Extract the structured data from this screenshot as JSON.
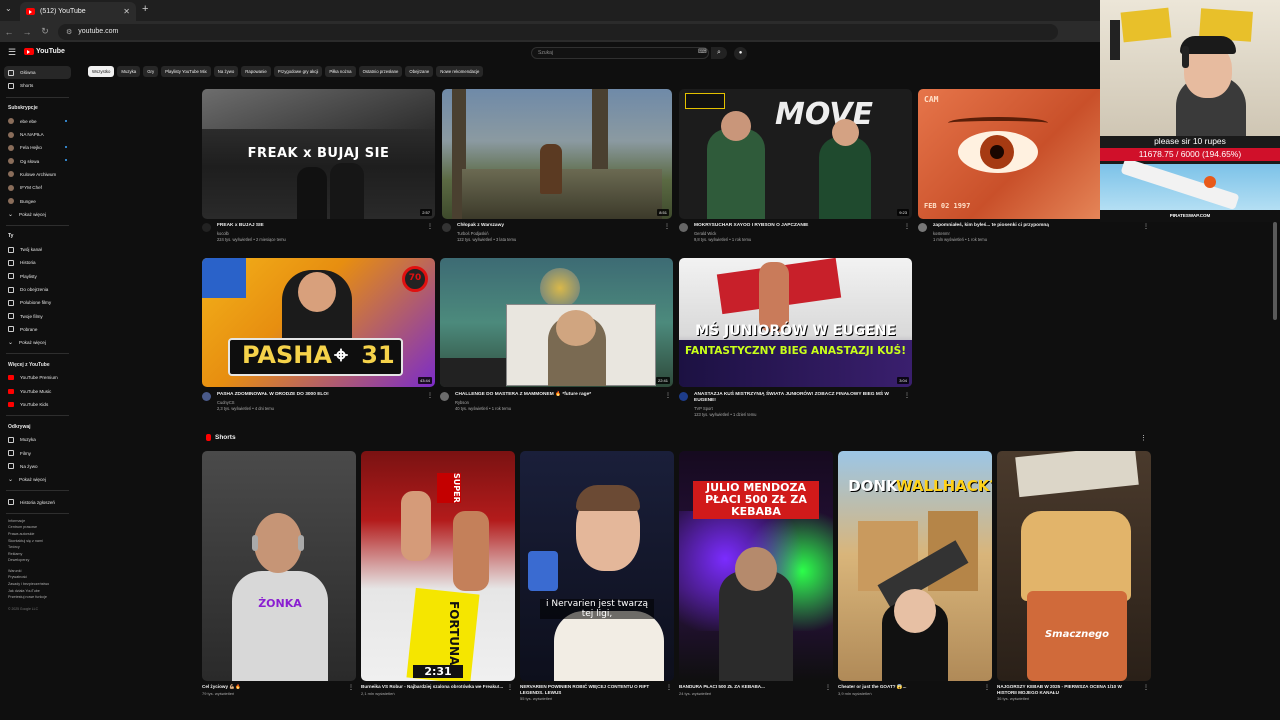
{
  "browser": {
    "tab_title": "(512) YouTube",
    "url": "youtube.com"
  },
  "yt": {
    "logo_text": "YouTube",
    "search_placeholder": "Szukaj"
  },
  "sidebar": {
    "home": "Główna",
    "shorts": "Shorts",
    "subs_header": "Subskrypcje",
    "subs": [
      "ebe ebe",
      "NA NAPIŁA",
      "Fela Hejko",
      "Og słowa",
      "Kulowe Archiwum",
      "IFYM Chef",
      "Bungee",
      "Pokaż więcej"
    ],
    "you_header": "Ty",
    "you": [
      "Twój kanał",
      "Historia",
      "Playlisty",
      "Do obejrzenia",
      "Polubione filmy",
      "Twoje filmy",
      "Pobrane",
      "Pokaż więcej"
    ],
    "more_header": "Więcej z YouTube",
    "more": [
      "YouTube Premium",
      "YouTube Music",
      "YouTube Kids"
    ],
    "explore_header": "Odkrywaj",
    "explore": [
      "Muzyka",
      "Filmy",
      "Na żywo",
      "Pokaż więcej"
    ],
    "history_reports": "Historia zgłoszeń",
    "footer1": [
      "Informacje",
      "Centrum prasowe",
      "Prawa autorskie",
      "Skontaktuj się z nami",
      "Twórcy",
      "Reklamy",
      "Deweloperzy"
    ],
    "footer2": [
      "Warunki",
      "Prywatność",
      "Zasady i bezpieczeństwo",
      "Jak działa YouTube",
      "Przetestuj nowe funkcje"
    ],
    "copyright": "© 2025 Google LLC"
  },
  "chips": [
    "Wszystko",
    "Muzyka",
    "Gry",
    "Playlisty YouTube Mix",
    "Na żywo",
    "Rapowanie",
    "Przygodowe gry akcji",
    "Piłka nożna",
    "Ostatnio przesłane",
    "Obejrzane",
    "Nowe rekomendacje"
  ],
  "videos": [
    {
      "title": "FREAK x BUJAJ SIE",
      "channel": "kocolb",
      "views": "224 tys. wyświetleń • 2 miesiące temu",
      "duration": "2:57",
      "thumb_text": "FREAK x BUJAJ SIE"
    },
    {
      "title": "Chłopak z Warszawy",
      "channel": "Turboś Podjaskiń",
      "views": "122 tys. wyświetleń • 3 lata temu",
      "duration": "8:51"
    },
    {
      "title": "MOKRYSUCHAR XAYOO I RYBSON O JAPCZANIE",
      "channel": "Gerald Wick",
      "views": "9,8 tys. wyświetleń • 1 rok temu",
      "duration": "9:23",
      "thumb_text": "MOVE"
    },
    {
      "title": "zapomniałeś, kim byłeś... te piosenki ci przypomną",
      "channel": "kostenmr",
      "views": "1 mln wyświetleń • 1 rok temu",
      "duration": "",
      "thumb_text": "CAM",
      "thumb_date": "FEB 02 1997"
    },
    {
      "title": "PASHA ZDOMINOWAŁ W DRODZE DO 3000 ELO!",
      "channel": "CudnyCS",
      "views": "2,3 tys. wyświetleń • 4 dni temu",
      "duration": "43:44",
      "thumb_text": "PASHA",
      "thumb_num": "31",
      "thumb_badge": "70"
    },
    {
      "title": "CHALLENGE DO MASTERA Z MAMMONEM 🔥 *future rage*",
      "channel": "Rybson",
      "views": "40 tys. wyświetleń • 1 rok temu",
      "duration": "22:41"
    },
    {
      "title": "ANASTAZJA KUŚ MISTRZYNIĄ ŚWIATA JUNIORÓW! ZOBACZ FINAŁOWY BIEG MŚ W EUGENE!",
      "channel": "TVP Sport",
      "views": "123 tys. wyświetleń • 1 dzień temu",
      "duration": "3:04",
      "thumb_text_1": "MŚ JUNIORÓW W EUGENE",
      "thumb_text_2": "FANTASTYCZNY BIEG ANASTAZJI KUŚ!"
    }
  ],
  "shorts": {
    "header": "Shorts",
    "items": [
      {
        "title": "Cel życiowy 💪🏼🔥",
        "views": "79 tys. wyświetleń",
        "overlay": "ŻONKA"
      },
      {
        "title": "Burneika VS Robur - Najbardziej szalona obrotówka we Freaku!...",
        "views": "2,1 mln wyświetleń",
        "overlay": "2:31",
        "overlay2": "FORTUNA",
        "overlay3": "SUPER"
      },
      {
        "title": "NERVARIEN POWINIEN ROBIĆ WIĘCEJ CONTENTU O RIFT LEGENDS. LEWUS",
        "views": "55 tys. wyświetleń",
        "overlay": "i Nervarien jest twarzą tej ligi,"
      },
      {
        "title": "BANDURA PŁACI 500 ZŁ ZA KEBABA...",
        "views": "24 tys. wyświetleń",
        "overlay": "JULIO MENDOZA PŁACI 500 ZŁ ZA KEBABA"
      },
      {
        "title": "Cheater or just the GOAT? 😱...",
        "views": "3,9 mln wyświetleń",
        "overlay": "DONK",
        "overlay2": "WALLHACK?"
      },
      {
        "title": "NAJGORSZY KEBAB W 2025 - PIERWSZA OCENA 1/10 W HISTORII MOJEGO KANAŁU",
        "views": "36 tys. wyświetleń",
        "overlay": "Smacznego"
      }
    ]
  },
  "overlay": {
    "donation_text": "please sir 10 rupes",
    "goal": "11678.75 / 6000 (194.65%)",
    "goal_fraction": 1.9465,
    "site": "PIRATESWAP.COM"
  }
}
